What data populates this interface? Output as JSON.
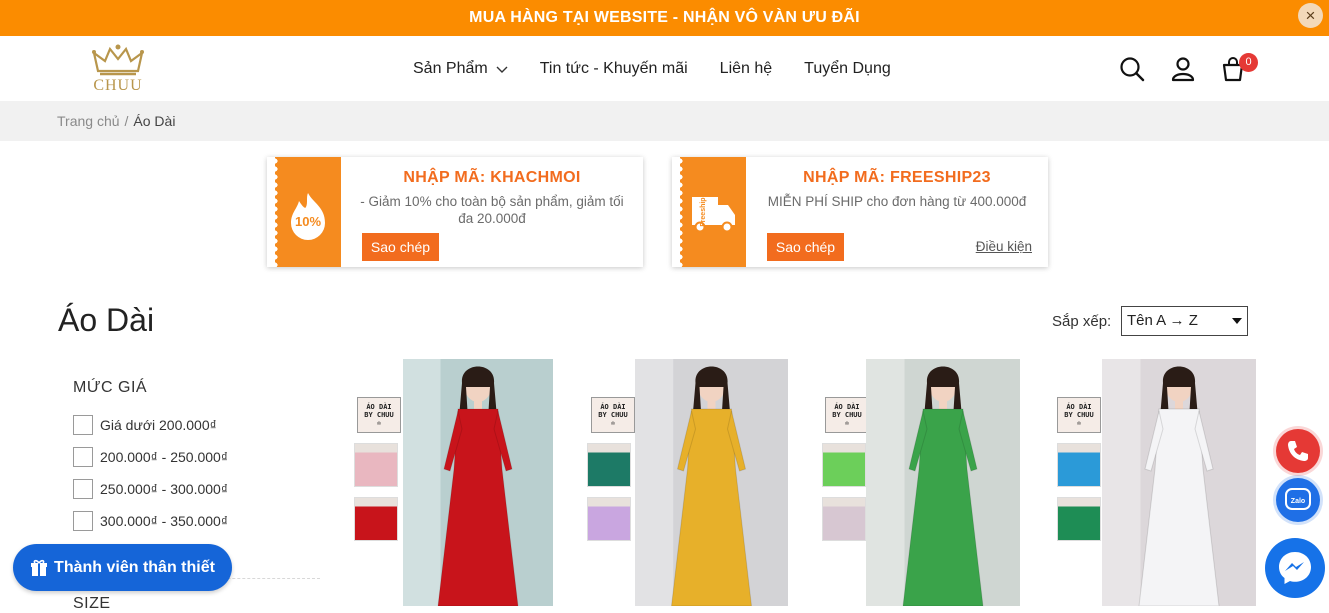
{
  "promo_bar": {
    "text": "MUA HÀNG TẠI WEBSITE - NHẬN VÔ VÀN ƯU ĐÃI",
    "close_glyph": "×"
  },
  "header": {
    "logo_text": "CHUU",
    "nav": [
      {
        "label": "Sản Phẩm",
        "has_dropdown": true
      },
      {
        "label": "Tin tức - Khuyến mãi"
      },
      {
        "label": "Liên hệ"
      },
      {
        "label": "Tuyển Dụng"
      }
    ],
    "icons": [
      "search-icon",
      "user-icon",
      "cart-icon"
    ],
    "cart_count": "0"
  },
  "breadcrumb": {
    "home": "Trang chủ",
    "separator": "/",
    "current": "Áo Dài"
  },
  "coupons": [
    {
      "icon_text": "10%",
      "title": "NHẬP MÃ: KHACHMOI",
      "description": "- Giảm 10% cho toàn bộ sản phẩm, giảm tối đa 20.000đ",
      "copy_label": "Sao chép"
    },
    {
      "icon_text": "Freeship",
      "title": "NHẬP MÃ: FREESHIP23",
      "description": "MIỄN PHÍ SHIP cho đơn hàng từ 400.000đ",
      "copy_label": "Sao chép",
      "conditions_label": "Điều kiện"
    }
  ],
  "collection": {
    "title": "Áo Dài",
    "sort_label": "Sắp xếp:",
    "sort_value": "Tên A → Z"
  },
  "filters": {
    "price_title": "MỨC GIÁ",
    "price_options": [
      "Giá dưới 200.000₫",
      "200.000₫ - 250.000₫",
      "250.000₫ - 300.000₫",
      "300.000₫ - 350.000₫"
    ],
    "size_title": "SIZE"
  },
  "products": [
    {
      "badge_lines": [
        "ÁO DÀI",
        "BY CHUU",
        "♔"
      ],
      "dress_color": "#c8141b",
      "thumb_colors": [
        "#e9b7c0",
        "#c8141b"
      ]
    },
    {
      "badge_lines": [
        "ÁO DÀI",
        "BY CHUU",
        "♔"
      ],
      "dress_color": "#e7b02a",
      "thumb_colors": [
        "#1d7a66",
        "#c9a6e0"
      ]
    },
    {
      "badge_lines": [
        "ÁO DÀI",
        "BY CHUU",
        "♔"
      ],
      "dress_color": "#3aa34a",
      "thumb_colors": [
        "#6ccf5a",
        "#d7c7d2"
      ]
    },
    {
      "badge_lines": [
        "ÁO DÀI",
        "BY CHUU",
        "♔"
      ],
      "dress_color": "#f4f4f6",
      "thumb_colors": [
        "#2b9ad8",
        "#1e8d55"
      ]
    }
  ],
  "floating": {
    "member_label": "Thành viên thân thiết",
    "zalo_label": "Zalo"
  },
  "colors": {
    "accent": "#fb8c00",
    "coupon_orange": "#f26c1e",
    "member_blue": "#1565d8",
    "phone_red": "#e53935"
  }
}
